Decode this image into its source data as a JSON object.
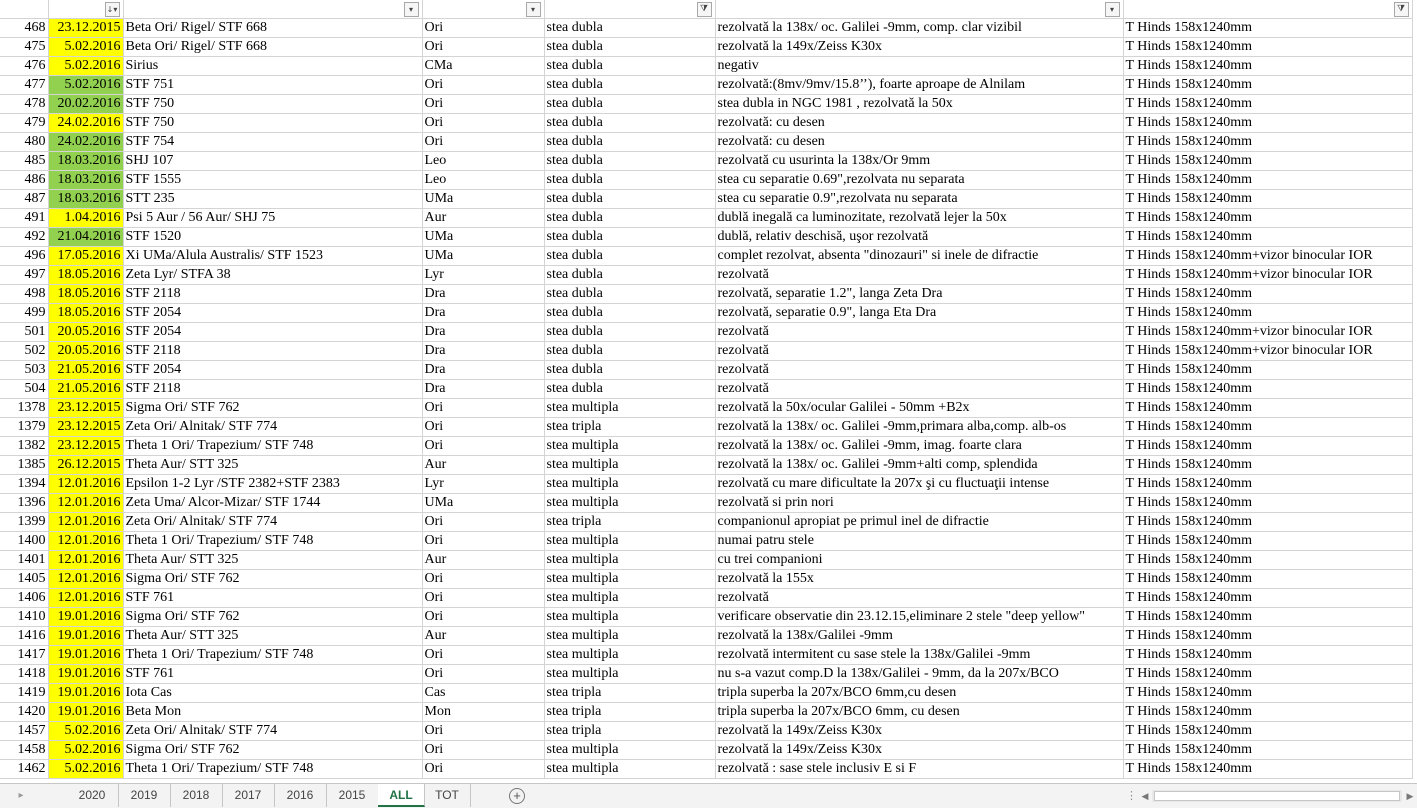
{
  "colors": {
    "date_yellow": "#ffff00",
    "date_green": "#92d050",
    "tab_active": "#217346",
    "grid": "#d4d4d4"
  },
  "header": {
    "filters": [
      {
        "col": "date",
        "icon": "sort-desc-filter-icon",
        "glyph": "↓▾"
      },
      {
        "col": "constellation",
        "icon": "dropdown-filter-icon",
        "glyph": "▾"
      },
      {
        "col": "type",
        "icon": "dropdown-filter-icon",
        "glyph": "▾"
      },
      {
        "col": "type_right",
        "icon": "active-filter-icon",
        "glyph": "⧩"
      },
      {
        "col": "note",
        "icon": "dropdown-filter-icon",
        "glyph": "▾"
      },
      {
        "col": "equipment",
        "icon": "active-filter-icon",
        "glyph": "⧩"
      }
    ]
  },
  "rows": [
    {
      "num": "468",
      "date": "23.12.2015",
      "hl": "yellow",
      "name": "Beta Ori/ Rigel/ STF 668",
      "con": "Ori",
      "type": "stea dubla",
      "note": "rezolvată la 138x/ oc. Galilei -9mm, comp. clar vizibil",
      "eq": "T Hinds 158x1240mm"
    },
    {
      "num": "475",
      "date": "5.02.2016",
      "hl": "yellow",
      "name": "Beta Ori/ Rigel/ STF 668",
      "con": "Ori",
      "type": "stea dubla",
      "note": "rezolvată la 149x/Zeiss K30x",
      "eq": "T Hinds 158x1240mm"
    },
    {
      "num": "476",
      "date": "5.02.2016",
      "hl": "yellow",
      "name": "Sirius",
      "con": "CMa",
      "type": "stea dubla",
      "note": "negativ",
      "eq": "T Hinds 158x1240mm"
    },
    {
      "num": "477",
      "date": "5.02.2016",
      "hl": "green",
      "name": "STF 751",
      "con": "Ori",
      "type": "stea dubla",
      "note": "rezolvată:(8mv/9mv/15.8’’), foarte aproape de Alnilam",
      "eq": "T Hinds 158x1240mm"
    },
    {
      "num": "478",
      "date": "20.02.2016",
      "hl": "green",
      "name": "STF 750",
      "con": "Ori",
      "type": "stea dubla",
      "note": "stea dubla in NGC 1981 , rezolvată la 50x",
      "eq": "T Hinds 158x1240mm"
    },
    {
      "num": "479",
      "date": "24.02.2016",
      "hl": "yellow",
      "name": "STF 750",
      "con": "Ori",
      "type": "stea dubla",
      "note": "rezolvată: cu desen",
      "eq": "T Hinds 158x1240mm"
    },
    {
      "num": "480",
      "date": "24.02.2016",
      "hl": "green",
      "name": "STF 754",
      "con": "Ori",
      "type": "stea dubla",
      "note": "rezolvată: cu desen",
      "eq": "T Hinds 158x1240mm"
    },
    {
      "num": "485",
      "date": "18.03.2016",
      "hl": "green",
      "name": "SHJ 107",
      "con": "Leo",
      "type": "stea dubla",
      "note": "rezolvată cu usurinta la 138x/Or 9mm",
      "eq": "T Hinds 158x1240mm"
    },
    {
      "num": "486",
      "date": "18.03.2016",
      "hl": "green",
      "name": "STF 1555",
      "con": "Leo",
      "type": "stea dubla",
      "note": "stea cu separatie 0.69\",rezolvata nu separata",
      "eq": "T Hinds 158x1240mm"
    },
    {
      "num": "487",
      "date": "18.03.2016",
      "hl": "green",
      "name": "STT 235",
      "con": "UMa",
      "type": "stea dubla",
      "note": "stea cu separatie 0.9\",rezolvata nu separata",
      "eq": "T Hinds 158x1240mm"
    },
    {
      "num": "491",
      "date": "1.04.2016",
      "hl": "yellow",
      "name": "Psi 5 Aur / 56 Aur/ SHJ 75",
      "con": "Aur",
      "type": "stea dubla",
      "note": "dublă inegală ca luminozitate, rezolvată lejer la 50x",
      "eq": "T Hinds 158x1240mm"
    },
    {
      "num": "492",
      "date": "21.04.2016",
      "hl": "green",
      "name": "STF 1520",
      "con": "UMa",
      "type": "stea dubla",
      "note": "dublă, relativ deschisă, uşor rezolvată",
      "eq": "T Hinds 158x1240mm"
    },
    {
      "num": "496",
      "date": "17.05.2016",
      "hl": "yellow",
      "name": "Xi UMa/Alula Australis/ STF 1523",
      "con": "UMa",
      "type": "stea dubla",
      "note": "complet rezolvat, absenta \"dinozauri\" si inele de difractie",
      "eq": "T Hinds 158x1240mm+vizor binocular IOR"
    },
    {
      "num": "497",
      "date": "18.05.2016",
      "hl": "yellow",
      "name": "Zeta Lyr/ STFA 38",
      "con": "Lyr",
      "type": "stea dubla",
      "note": "rezolvată",
      "eq": "T Hinds 158x1240mm+vizor binocular IOR"
    },
    {
      "num": "498",
      "date": "18.05.2016",
      "hl": "yellow",
      "name": "STF 2118",
      "con": "Dra",
      "type": "stea dubla",
      "note": "rezolvată, separatie 1.2\", langa Zeta Dra",
      "eq": "T Hinds 158x1240mm"
    },
    {
      "num": "499",
      "date": "18.05.2016",
      "hl": "yellow",
      "name": "STF 2054",
      "con": "Dra",
      "type": "stea dubla",
      "note": "rezolvată, separatie 0.9\", langa Eta Dra",
      "eq": "T Hinds 158x1240mm"
    },
    {
      "num": "501",
      "date": "20.05.2016",
      "hl": "yellow",
      "name": "STF 2054",
      "con": "Dra",
      "type": "stea dubla",
      "note": "rezolvată",
      "eq": "T Hinds 158x1240mm+vizor binocular IOR"
    },
    {
      "num": "502",
      "date": "20.05.2016",
      "hl": "yellow",
      "name": "STF 2118",
      "con": "Dra",
      "type": "stea dubla",
      "note": "rezolvată",
      "eq": "T Hinds 158x1240mm+vizor binocular IOR"
    },
    {
      "num": "503",
      "date": "21.05.2016",
      "hl": "yellow",
      "name": "STF 2054",
      "con": "Dra",
      "type": "stea dubla",
      "note": "rezolvată",
      "eq": "T Hinds 158x1240mm"
    },
    {
      "num": "504",
      "date": "21.05.2016",
      "hl": "yellow",
      "name": "STF 2118",
      "con": "Dra",
      "type": "stea dubla",
      "note": "rezolvată",
      "eq": "T Hinds 158x1240mm"
    },
    {
      "num": "1378",
      "date": "23.12.2015",
      "hl": "yellow",
      "name": "Sigma Ori/ STF 762",
      "con": "Ori",
      "type": "stea multipla",
      "note": "rezolvată la 50x/ocular Galilei - 50mm +B2x",
      "eq": "T Hinds 158x1240mm"
    },
    {
      "num": "1379",
      "date": "23.12.2015",
      "hl": "yellow",
      "name": " Zeta Ori/ Alnitak/ STF 774",
      "con": "Ori",
      "type": "stea tripla",
      "note": "rezolvată la 138x/ oc. Galilei -9mm,primara alba,comp. alb-os",
      "eq": "T Hinds 158x1240mm"
    },
    {
      "num": "1382",
      "date": "23.12.2015",
      "hl": "yellow",
      "name": "Theta 1 Ori/ Trapezium/ STF 748",
      "con": "Ori",
      "type": "stea multipla",
      "note": "rezolvată la 138x/ oc. Galilei -9mm, imag. foarte clara",
      "eq": "T Hinds 158x1240mm"
    },
    {
      "num": "1385",
      "date": "26.12.2015",
      "hl": "yellow",
      "name": "Theta Aur/ STT 325",
      "con": "Aur",
      "type": "stea multipla",
      "note": "rezolvată la 138x/ oc. Galilei -9mm+alti comp, splendida",
      "eq": "T Hinds 158x1240mm"
    },
    {
      "num": "1394",
      "date": "12.01.2016",
      "hl": "yellow",
      "name": "Epsilon 1-2 Lyr /STF 2382+STF 2383",
      "con": "Lyr",
      "type": "stea multipla",
      "note": "rezolvată cu mare dificultate la 207x şi cu fluctuaţii intense",
      "eq": "T Hinds 158x1240mm"
    },
    {
      "num": "1396",
      "date": "12.01.2016",
      "hl": "yellow",
      "name": " Zeta Uma/ Alcor-Mizar/ STF 1744",
      "con": "UMa",
      "type": "stea multipla",
      "note": "rezolvată si prin nori",
      "eq": "T Hinds 158x1240mm"
    },
    {
      "num": "1399",
      "date": "12.01.2016",
      "hl": "yellow",
      "name": " Zeta Ori/ Alnitak/ STF 774",
      "con": "Ori",
      "type": "stea tripla",
      "note": "companionul apropiat pe primul inel de difractie",
      "eq": "T Hinds 158x1240mm"
    },
    {
      "num": "1400",
      "date": "12.01.2016",
      "hl": "yellow",
      "name": "Theta 1 Ori/ Trapezium/ STF 748",
      "con": "Ori",
      "type": "stea multipla",
      "note": " numai patru stele",
      "eq": "T Hinds 158x1240mm"
    },
    {
      "num": "1401",
      "date": "12.01.2016",
      "hl": "yellow",
      "name": "Theta Aur/ STT 325",
      "con": "Aur",
      "type": "stea multipla",
      "note": "cu trei companioni",
      "eq": "T Hinds 158x1240mm"
    },
    {
      "num": "1405",
      "date": "12.01.2016",
      "hl": "yellow",
      "name": "Sigma Ori/ STF 762",
      "con": "Ori",
      "type": "stea multipla",
      "note": "rezolvată la 155x",
      "eq": "T Hinds 158x1240mm"
    },
    {
      "num": "1406",
      "date": "12.01.2016",
      "hl": "yellow",
      "name": "STF 761",
      "con": "Ori",
      "type": "stea multipla",
      "note": "rezolvată",
      "eq": "T Hinds 158x1240mm"
    },
    {
      "num": "1410",
      "date": "19.01.2016",
      "hl": "yellow",
      "name": "Sigma Ori/ STF 762",
      "con": "Ori",
      "type": "stea multipla",
      "note": "verificare observatie din 23.12.15,eliminare 2 stele \"deep yellow\"",
      "eq": "T Hinds 158x1240mm"
    },
    {
      "num": "1416",
      "date": "19.01.2016",
      "hl": "yellow",
      "name": "Theta Aur/ STT 325",
      "con": "Aur",
      "type": "stea multipla",
      "note": "rezolvată la 138x/Galilei -9mm",
      "eq": "T Hinds 158x1240mm"
    },
    {
      "num": "1417",
      "date": "19.01.2016",
      "hl": "yellow",
      "name": "Theta 1 Ori/ Trapezium/ STF 748",
      "con": "Ori",
      "type": "stea multipla",
      "note": "rezolvată intermitent cu sase stele la 138x/Galilei -9mm",
      "eq": "T Hinds 158x1240mm"
    },
    {
      "num": "1418",
      "date": "19.01.2016",
      "hl": "yellow",
      "name": "STF 761",
      "con": "Ori",
      "type": "stea multipla",
      "note": "nu s-a vazut comp.D la 138x/Galilei - 9mm, da la 207x/BCO",
      "eq": "T Hinds 158x1240mm"
    },
    {
      "num": "1419",
      "date": "19.01.2016",
      "hl": "yellow",
      "name": "Iota Cas",
      "con": "Cas",
      "type": "stea tripla",
      "note": "tripla superba la 207x/BCO 6mm,cu desen",
      "eq": "T Hinds 158x1240mm"
    },
    {
      "num": "1420",
      "date": "19.01.2016",
      "hl": "yellow",
      "name": "Beta Mon",
      "con": "Mon",
      "type": "stea tripla",
      "note": "tripla superba la 207x/BCO 6mm, cu desen",
      "eq": "T Hinds 158x1240mm"
    },
    {
      "num": "1457",
      "date": "5.02.2016",
      "hl": "yellow",
      "name": " Zeta Ori/ Alnitak/ STF 774",
      "con": "Ori",
      "type": "stea tripla",
      "note": "rezolvată la 149x/Zeiss K30x",
      "eq": "T Hinds 158x1240mm"
    },
    {
      "num": "1458",
      "date": "5.02.2016",
      "hl": "yellow",
      "name": "Sigma Ori/ STF 762",
      "con": "Ori",
      "type": "stea multipla",
      "note": "rezolvată la 149x/Zeiss K30x",
      "eq": "T Hinds 158x1240mm"
    },
    {
      "num": "1462",
      "date": "5.02.2016",
      "hl": "yellow",
      "name": "Theta 1 Ori/ Trapezium/ STF 748",
      "con": "Ori",
      "type": "stea multipla",
      "note": "rezolvată : sase stele inclusiv E si F",
      "eq": "T Hinds 158x1240mm"
    }
  ],
  "tabs": [
    {
      "label": "2020",
      "active": false
    },
    {
      "label": "2019",
      "active": false
    },
    {
      "label": "2018",
      "active": false
    },
    {
      "label": "2017",
      "active": false
    },
    {
      "label": "2016",
      "active": false
    },
    {
      "label": "2015",
      "active": false
    },
    {
      "label": "ALL",
      "active": true
    },
    {
      "label": "TOT",
      "active": false
    }
  ],
  "tabbar": {
    "add_icon": "plus-circle-icon",
    "prev_icon": "triangle-left-icon",
    "more_icon": "ellipsis-icon"
  }
}
